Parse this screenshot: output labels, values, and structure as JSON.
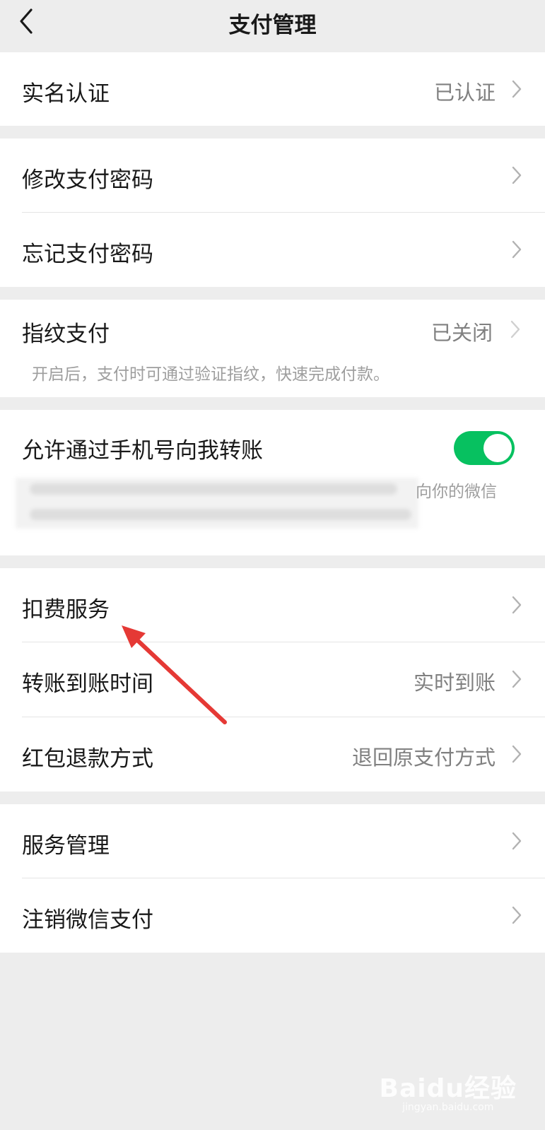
{
  "nav": {
    "title": "支付管理",
    "back_icon": "chevron-left-icon"
  },
  "groups": {
    "real_name": {
      "label": "实名认证",
      "value": "已认证"
    },
    "change_pwd": {
      "label": "修改支付密码"
    },
    "forgot_pwd": {
      "label": "忘记支付密码"
    },
    "fingerprint": {
      "label": "指纹支付",
      "value": "已关闭",
      "desc": "开启后，支付时可通过验证指纹，快速完成付款。"
    },
    "phone_transfer": {
      "label": "允许通过手机号向我转账",
      "toggle_on": true,
      "desc_visible_tail": "向你的微信"
    },
    "deduction": {
      "label": "扣费服务"
    },
    "transfer_time": {
      "label": "转账到账时间",
      "value": "实时到账"
    },
    "redpacket_refund": {
      "label": "红包退款方式",
      "value": "退回原支付方式"
    },
    "service_mgmt": {
      "label": "服务管理"
    },
    "cancel_pay": {
      "label": "注销微信支付"
    }
  },
  "colors": {
    "accent": "#07c160",
    "background": "#ededed",
    "annotation_arrow": "#e53935"
  },
  "watermark": {
    "logo": "Baidu经验",
    "url": "jingyan.baidu.com"
  }
}
